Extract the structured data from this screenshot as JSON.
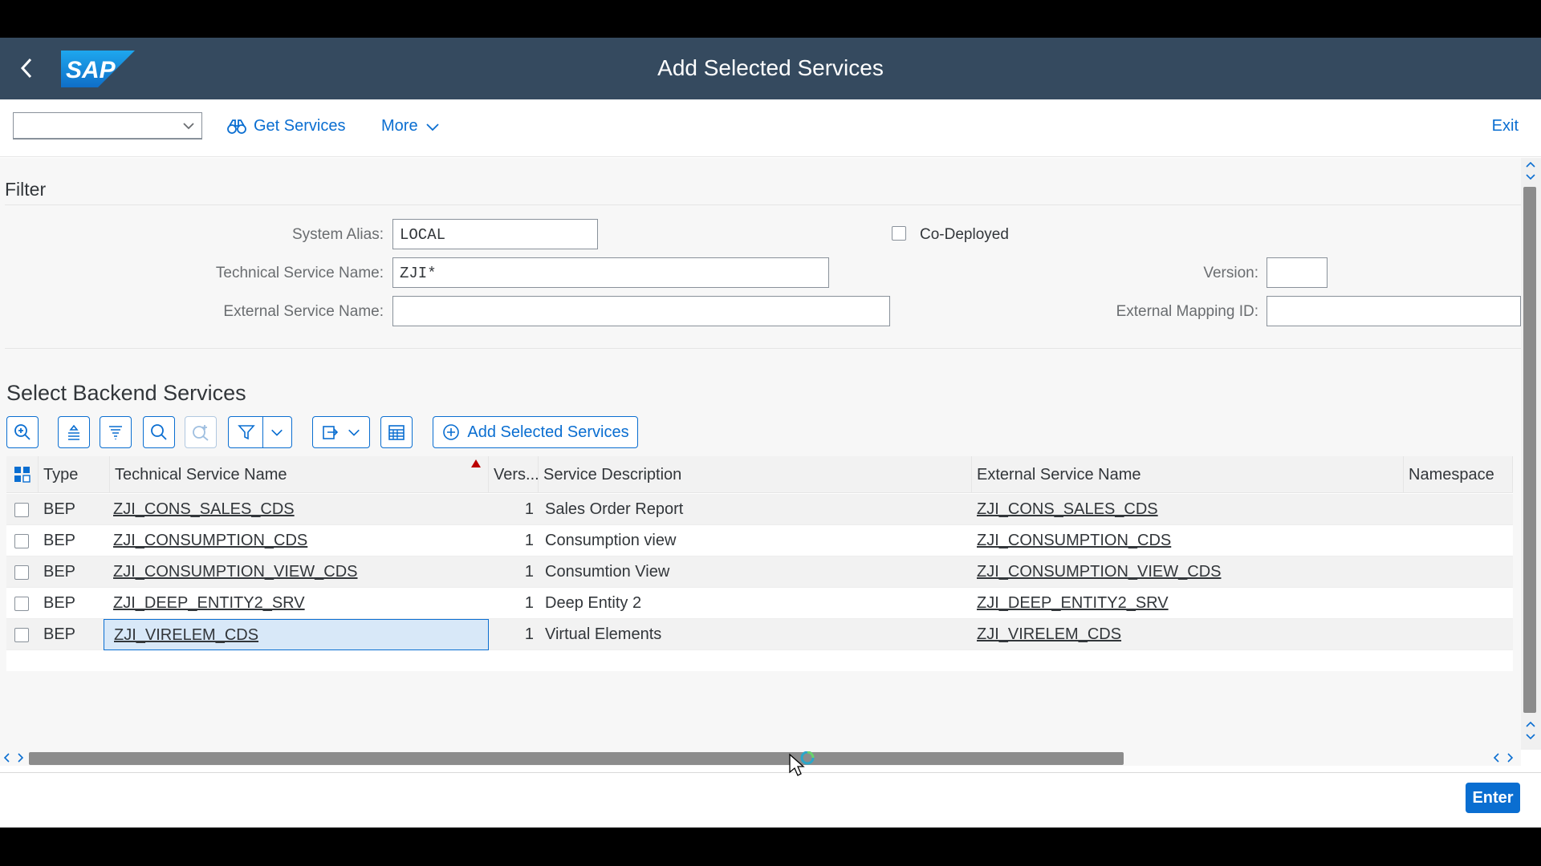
{
  "shell": {
    "title": "Add Selected Services",
    "logo_text": "SAP",
    "back_icon": "chevron-left-icon"
  },
  "toolbar": {
    "command_field_value": "",
    "get_services_label": "Get Services",
    "more_label": "More",
    "exit_label": "Exit"
  },
  "filter": {
    "title": "Filter",
    "system_alias_label": "System Alias:",
    "system_alias_value": "LOCAL",
    "technical_service_name_label": "Technical Service Name:",
    "technical_service_name_value": "ZJI*",
    "external_service_name_label": "External Service Name:",
    "external_service_name_value": "",
    "co_deployed_label": "Co-Deployed",
    "co_deployed_checked": false,
    "version_label": "Version:",
    "version_value": "",
    "external_mapping_id_label": "External Mapping ID:",
    "external_mapping_id_value": ""
  },
  "backend": {
    "title": "Select Backend Services",
    "add_selected_label": "Add Selected Services",
    "columns": [
      "Type",
      "Technical Service Name",
      "Vers...",
      "Service Description",
      "External Service Name",
      "Namespace"
    ],
    "rows": [
      {
        "type": "BEP",
        "tech_name": "ZJI_CONS_SALES_CDS",
        "version": "1",
        "description": "Sales Order Report",
        "ext_name": "ZJI_CONS_SALES_CDS",
        "namespace": ""
      },
      {
        "type": "BEP",
        "tech_name": "ZJI_CONSUMPTION_CDS",
        "version": "1",
        "description": "Consumption view",
        "ext_name": "ZJI_CONSUMPTION_CDS",
        "namespace": ""
      },
      {
        "type": "BEP",
        "tech_name": "ZJI_CONSUMPTION_VIEW_CDS",
        "version": "1",
        "description": "Consumtion View",
        "ext_name": "ZJI_CONSUMPTION_VIEW_CDS",
        "namespace": ""
      },
      {
        "type": "BEP",
        "tech_name": "ZJI_DEEP_ENTITY2_SRV",
        "version": "1",
        "description": "Deep Entity 2",
        "ext_name": "ZJI_DEEP_ENTITY2_SRV",
        "namespace": ""
      },
      {
        "type": "BEP",
        "tech_name": "ZJI_VIRELEM_CDS",
        "version": "1",
        "description": "Virtual Elements",
        "ext_name": "ZJI_VIRELEM_CDS",
        "namespace": ""
      }
    ]
  },
  "footer": {
    "enter_label": "Enter"
  },
  "colors": {
    "shell_bg": "#354a5f",
    "accent": "#0a6ed1",
    "sort_indicator": "#bb0000"
  }
}
